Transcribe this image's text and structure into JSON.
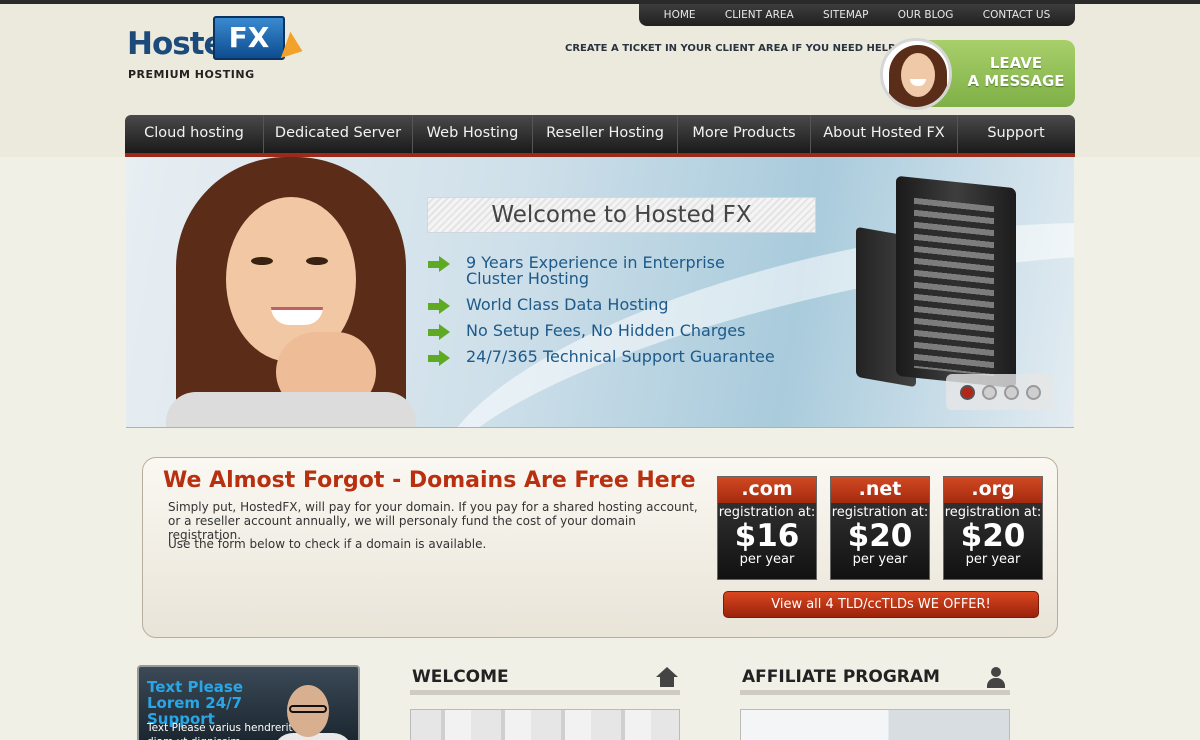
{
  "top_nav": [
    "HOME",
    "CLIENT AREA",
    "SITEMAP",
    "OUR BLOG",
    "CONTACT US"
  ],
  "logo": {
    "word": "Hosted",
    "mark": "FX",
    "tagline": "PREMIUM HOSTING"
  },
  "help_text": "CREATE A TICKET IN YOUR CLIENT AREA IF YOU NEED HELP!",
  "leave_message": {
    "line1": "LEAVE",
    "line2": "A MESSAGE"
  },
  "main_nav": [
    "Cloud hosting",
    "Dedicated Server",
    "Web Hosting",
    "Reseller Hosting",
    "More Products",
    "About Hosted FX",
    "Support"
  ],
  "hero": {
    "title": "Welcome to Hosted FX",
    "bullets": [
      "9 Years Experience in Enterprise Cluster Hosting",
      "World Class Data Hosting",
      "No Setup Fees, No Hidden Charges",
      "24/7/365 Technical Support Guarantee"
    ],
    "active_slide": 1
  },
  "domains": {
    "title": "We Almost Forgot - Domains Are Free Here",
    "text": "Simply put, HostedFX, will pay for your domain. If you pay for a shared hosting account, or a reseller account annually, we will personaly fund the cost of your domain registration.",
    "form_text": "Use the form below to check if a domain is available.",
    "tlds": [
      {
        "name": ".com",
        "reg": "registration at:",
        "price": "$16",
        "per": "per year"
      },
      {
        "name": ".net",
        "reg": "registration at:",
        "price": "$20",
        "per": "per year"
      },
      {
        "name": ".org",
        "reg": "registration at:",
        "price": "$20",
        "per": "per year"
      }
    ],
    "view_all": "View all 4 TLD/ccTLDs WE OFFER!"
  },
  "support_box": {
    "title": "Text Please Lorem 24/7 Support",
    "text": "Text Please varius hendrerit diam ut dignissim. Vestibulum"
  },
  "sections": {
    "welcome": "WELCOME",
    "affiliate": "AFFILIATE PROGRAM"
  },
  "colors": {
    "accent_red": "#b8300f",
    "accent_green": "#7fb047",
    "nav_dark": "#1a1a1a"
  }
}
